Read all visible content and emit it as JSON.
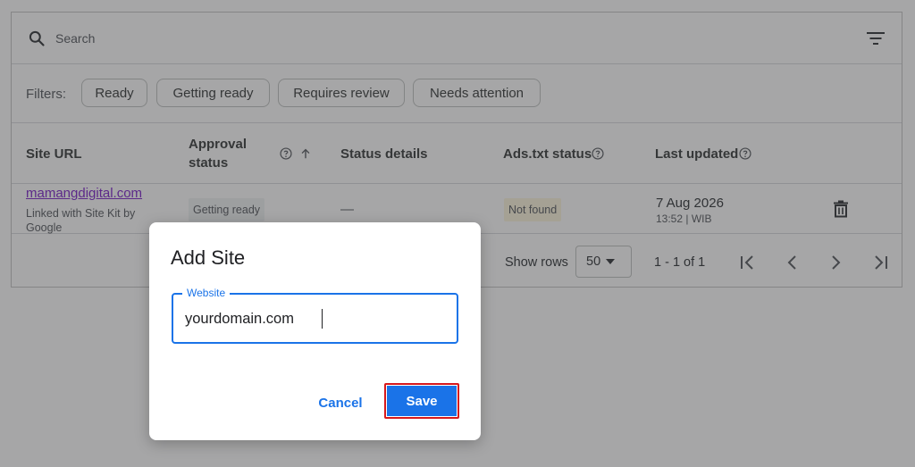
{
  "search": {
    "placeholder": "Search"
  },
  "filters": {
    "label": "Filters:",
    "chips": [
      "Ready",
      "Getting ready",
      "Requires review",
      "Needs attention"
    ]
  },
  "table": {
    "headers": {
      "site_url": "Site URL",
      "approval_line1": "Approval",
      "approval_line2": "status",
      "status_details": "Status details",
      "ads_txt": "Ads.txt status",
      "last_updated": "Last updated"
    },
    "rows": [
      {
        "site": "mamangdigital.com",
        "sub_line1": "Linked with Site Kit by",
        "sub_line2": "Google",
        "approval": "Getting ready",
        "details": "—",
        "ads_txt": "Not found",
        "date": "7 Aug 2026",
        "time": "13:52 | WIB"
      }
    ]
  },
  "pager": {
    "show_rows_label": "Show rows",
    "rows_value": "50",
    "range": "1 - 1 of 1"
  },
  "dialog": {
    "title": "Add Site",
    "field_label": "Website",
    "field_value": "yourdomain.com",
    "cancel_label": "Cancel",
    "save_label": "Save"
  },
  "colors": {
    "primary": "#1a73e8",
    "link_visited": "#8430ce",
    "highlight_border": "#d7191c",
    "scrim": "rgba(32,33,36,0.40)"
  },
  "icons": [
    "search-icon",
    "filter-list-icon",
    "help-icon",
    "arrow-up-icon",
    "trash-icon",
    "chevron-down-icon",
    "first-page-icon",
    "chevron-left-icon",
    "chevron-right-icon",
    "last-page-icon"
  ]
}
